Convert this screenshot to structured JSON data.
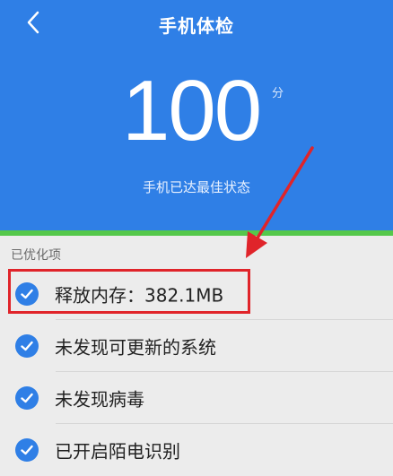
{
  "header": {
    "title": "手机体检",
    "back_icon": "back-arrow-icon",
    "background_color": "#2f7fe6",
    "accent_line_color": "#55c84b"
  },
  "score": {
    "value": "100",
    "unit": "分",
    "status": "手机已达最佳状态"
  },
  "section": {
    "title": "已优化项"
  },
  "items": [
    {
      "label": "释放内存：382.1MB",
      "icon": "check-circle-icon",
      "highlighted": true
    },
    {
      "label": "未发现可更新的系统",
      "icon": "check-circle-icon"
    },
    {
      "label": "未发现病毒",
      "icon": "check-circle-icon"
    },
    {
      "label": "已开启陌电识别",
      "icon": "check-circle-icon"
    }
  ],
  "annotation": {
    "highlight_color": "#e0242a",
    "arrow_icon": "red-arrow-icon"
  }
}
